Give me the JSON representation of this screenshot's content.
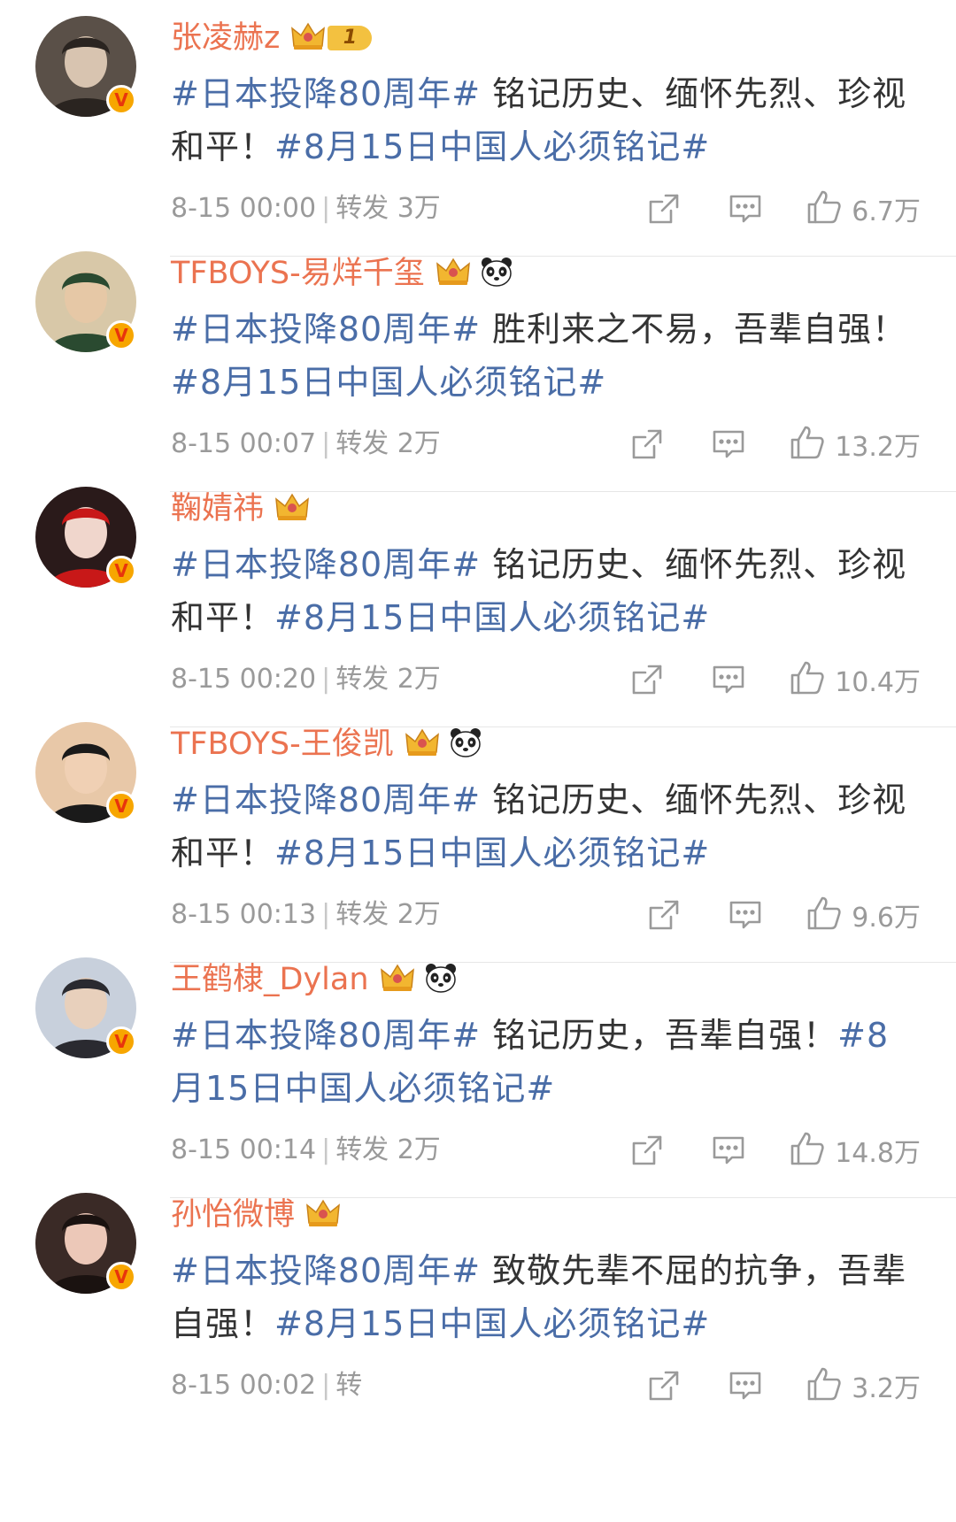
{
  "posts": [
    {
      "username": "张凌赫z",
      "level": "1",
      "has_panda": false,
      "avatar_colors": [
        "#5a5048",
        "#d8c4b0",
        "#2a2420"
      ],
      "content": [
        {
          "text": "#日本投降80周年#",
          "tag": true
        },
        {
          "text": " 铭记历史、缅怀先烈、珍视和平！",
          "tag": false
        },
        {
          "text": "#8月15日中国人必须铭记#",
          "tag": true
        }
      ],
      "time": "8-15 00:00",
      "repost": "转发 3万",
      "likes": "6.7万"
    },
    {
      "username": "TFBOYS-易烊千玺",
      "level": "",
      "has_panda": true,
      "avatar_colors": [
        "#d8c8a8",
        "#e6c8a6",
        "#2a4a30"
      ],
      "content": [
        {
          "text": "#日本投降80周年#",
          "tag": true
        },
        {
          "text": " 胜利来之不易，吾辈自强！",
          "tag": false
        },
        {
          "text": "#8月15日中国人必须铭记#",
          "tag": true
        }
      ],
      "time": "8-15 00:07",
      "repost": "转发 2万",
      "likes": "13.2万"
    },
    {
      "username": "鞠婧祎",
      "level": "",
      "has_panda": false,
      "avatar_colors": [
        "#2a1a1a",
        "#f0d6cc",
        "#c81818"
      ],
      "content": [
        {
          "text": "#日本投降80周年#",
          "tag": true
        },
        {
          "text": " 铭记历史、缅怀先烈、珍视和平！",
          "tag": false
        },
        {
          "text": "#8月15日中国人必须铭记#",
          "tag": true
        }
      ],
      "time": "8-15 00:20",
      "repost": "转发 2万",
      "likes": "10.4万"
    },
    {
      "username": "TFBOYS-王俊凯",
      "level": "",
      "has_panda": true,
      "avatar_colors": [
        "#e8c8a8",
        "#f0d0b4",
        "#1a1a1a"
      ],
      "content": [
        {
          "text": "#日本投降80周年#",
          "tag": true
        },
        {
          "text": " 铭记历史、缅怀先烈、珍视和平！",
          "tag": false
        },
        {
          "text": "#8月15日中国人必须铭记#",
          "tag": true
        }
      ],
      "time": "8-15 00:13",
      "repost": "转发 2万",
      "likes": "9.6万"
    },
    {
      "username": "王鹤棣_Dylan",
      "level": "",
      "has_panda": true,
      "avatar_colors": [
        "#c8d0dc",
        "#e8d0bc",
        "#2a2a30"
      ],
      "content": [
        {
          "text": "#日本投降80周年#",
          "tag": true
        },
        {
          "text": " 铭记历史，吾辈自强！",
          "tag": false
        },
        {
          "text": "#8月15日中国人必须铭记#",
          "tag": true
        }
      ],
      "time": "8-15 00:14",
      "repost": "转发 2万",
      "likes": "14.8万"
    },
    {
      "username": "孙怡微博",
      "level": "",
      "has_panda": false,
      "avatar_colors": [
        "#3a2a26",
        "#ecc8b8",
        "#1a1210"
      ],
      "content": [
        {
          "text": "#日本投降80周年#",
          "tag": true
        },
        {
          "text": " 致敬先辈不屈的抗争，吾辈自强！",
          "tag": false
        },
        {
          "text": "#8月15日中国人必须铭记#",
          "tag": true
        }
      ],
      "time": "8-15 00:02",
      "repost": "转",
      "likes": "3.2万"
    }
  ],
  "colors": {
    "username": "#eb7350",
    "hashtag": "#4a6da7",
    "text": "#333333",
    "meta": "#9a9a9a",
    "verified": "#f7a600"
  },
  "icons": {
    "verified": "verified-v-icon",
    "crown": "crown-icon",
    "panda": "panda-icon",
    "share": "share-icon",
    "comment": "comment-icon",
    "like": "thumbs-up-icon"
  },
  "verified_glyph": "V"
}
